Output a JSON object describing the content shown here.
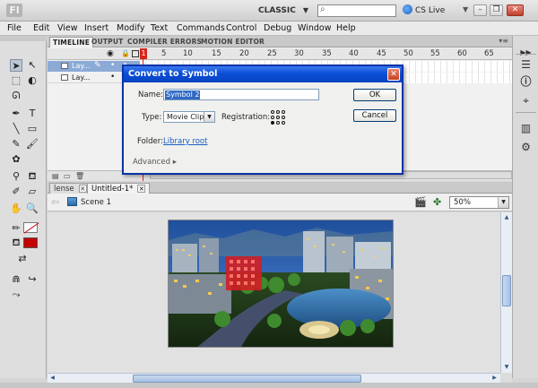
{
  "app": {
    "logo": "Fl",
    "workspace": "CLASSIC",
    "search_placeholder": "",
    "cs_live": "CS Live"
  },
  "menu": [
    "File",
    "Edit",
    "View",
    "Insert",
    "Modify",
    "Text",
    "Commands",
    "Control",
    "Debug",
    "Window",
    "Help"
  ],
  "timeline": {
    "tabs": [
      "TIMELINE",
      "OUTPUT",
      "COMPILER ERRORS",
      "MOTION EDITOR"
    ],
    "frame_numbers": [
      "1",
      "5",
      "10",
      "15",
      "20",
      "25",
      "30",
      "35",
      "40",
      "45",
      "50",
      "55",
      "60",
      "65"
    ],
    "layers": [
      {
        "name": "Lay...",
        "selected": true
      },
      {
        "name": "Lay...",
        "selected": false
      }
    ]
  },
  "documents": {
    "tabs": [
      {
        "label": "lense",
        "active": false
      },
      {
        "label": "Untitled-1*",
        "active": true
      }
    ]
  },
  "editbar": {
    "scene": "Scene 1",
    "zoom": "50%"
  },
  "dialog": {
    "title": "Convert to Symbol",
    "name_label": "Name:",
    "name_value": "Symbol 2",
    "type_label": "Type:",
    "type_value": "Movie Clip",
    "registration_label": "Registration:",
    "folder_label": "Folder:",
    "folder_value": "Library root",
    "advanced_label": "Advanced",
    "ok_label": "OK",
    "cancel_label": "Cancel"
  },
  "colors": {
    "accent": "#0a4ed6",
    "stroke": "#c00000",
    "fill": "#c40000",
    "playhead": "#d8221c"
  }
}
